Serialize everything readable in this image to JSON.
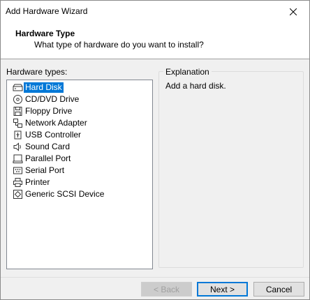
{
  "window": {
    "title": "Add Hardware Wizard"
  },
  "header": {
    "title": "Hardware Type",
    "subtitle": "What type of hardware do you want to install?"
  },
  "hardware": {
    "label": "Hardware types:",
    "items": [
      {
        "label": "Hard Disk",
        "icon": "hard-disk-icon",
        "selected": true
      },
      {
        "label": "CD/DVD Drive",
        "icon": "cd-dvd-icon"
      },
      {
        "label": "Floppy Drive",
        "icon": "floppy-icon"
      },
      {
        "label": "Network Adapter",
        "icon": "network-icon"
      },
      {
        "label": "USB Controller",
        "icon": "usb-icon"
      },
      {
        "label": "Sound Card",
        "icon": "speaker-icon"
      },
      {
        "label": "Parallel Port",
        "icon": "parallel-port-icon"
      },
      {
        "label": "Serial Port",
        "icon": "serial-port-icon"
      },
      {
        "label": "Printer",
        "icon": "printer-icon"
      },
      {
        "label": "Generic SCSI Device",
        "icon": "scsi-icon"
      }
    ]
  },
  "explanation": {
    "title": "Explanation",
    "text": "Add a hard disk."
  },
  "buttons": {
    "back": "< Back",
    "next": "Next >",
    "cancel": "Cancel"
  },
  "colors": {
    "selection": "#0078d7",
    "panel": "#f0f0f0"
  }
}
